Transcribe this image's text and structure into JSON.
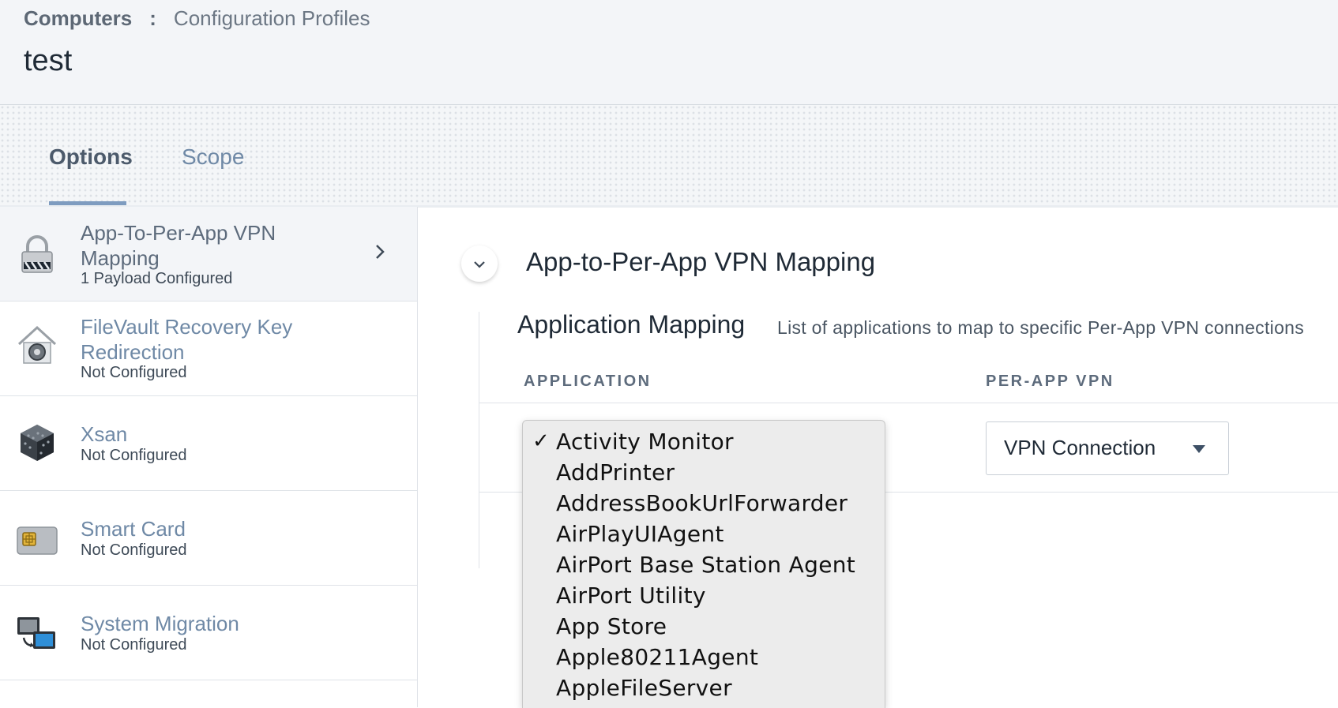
{
  "breadcrumb": {
    "root": "Computers",
    "separator": ":",
    "current": "Configuration Profiles"
  },
  "page": {
    "title": "test"
  },
  "tabs": [
    {
      "label": "Options",
      "active": true
    },
    {
      "label": "Scope",
      "active": false
    }
  ],
  "sidebar": {
    "items": [
      {
        "title": "App-To-Per-App VPN Mapping",
        "status": "1 Payload Configured",
        "icon": "lock-icon",
        "active": true
      },
      {
        "title": "FileVault Recovery Key Redirection",
        "status": "Not Configured",
        "icon": "filevault-house-icon"
      },
      {
        "title": "Xsan",
        "status": "Not Configured",
        "icon": "xsan-cube-icon"
      },
      {
        "title": "Smart Card",
        "status": "Not Configured",
        "icon": "smart-card-icon"
      },
      {
        "title": "System Migration",
        "status": "Not Configured",
        "icon": "system-migration-icon"
      }
    ]
  },
  "main": {
    "section_title": "App-to-Per-App VPN Mapping",
    "subsection_title": "Application Mapping",
    "subsection_description": "List of applications to map to specific Per-App VPN connections",
    "columns": {
      "application": "APPLICATION",
      "per_app_vpn": "PER-APP VPN"
    },
    "vpn_select": {
      "value": "VPN Connection"
    },
    "application_dropdown": {
      "selected": "Activity Monitor",
      "check": "✓",
      "options": [
        "Activity Monitor",
        "AddPrinter",
        "AddressBookUrlForwarder",
        "AirPlayUIAgent",
        "AirPort Base Station Agent",
        "AirPort Utility",
        "App Store",
        "Apple80211Agent",
        "AppleFileServer"
      ]
    }
  },
  "colors": {
    "accent": "#7e9cc0",
    "link": "#6f89a6",
    "header_bg": "#f3f5f8"
  }
}
